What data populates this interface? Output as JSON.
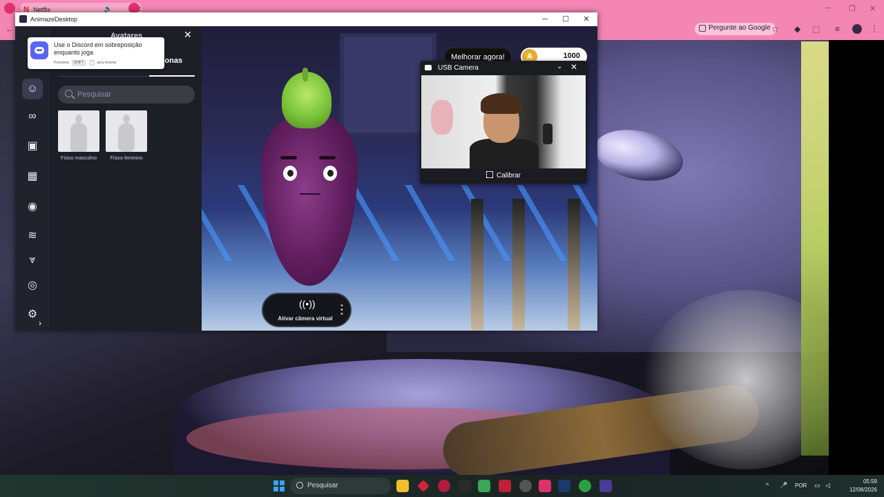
{
  "browser": {
    "tab_title": "Netflix",
    "google_button": "Pergunte ao Google"
  },
  "window": {
    "title": "AnimazeDesktop",
    "controls": {
      "minimize": "─",
      "maximize": "☐",
      "close": "✕"
    }
  },
  "discord_toast": {
    "message": "Use o Discord em sobreposição enquanto joga",
    "hint_prefix": "Pressione",
    "hint_key1": "SHIFT",
    "hint_key2": "`",
    "hint_suffix": "para mostrar"
  },
  "panel": {
    "title": "Avatares",
    "tab_active": "rsonas",
    "close": "✕",
    "search_placeholder": "Pesquisar",
    "avatars": [
      {
        "label": "Físico masculino"
      },
      {
        "label": "Físico feminino"
      }
    ]
  },
  "stage": {
    "upgrade_label": "Melhorar agora!",
    "coins": "1000",
    "coin_symbol": "A",
    "virtual_camera_label": "Ativar câmera virtual"
  },
  "camera_panel": {
    "title": "USB Camera",
    "calibrate_label": "Calibrar"
  },
  "taskbar": {
    "search_label": "Pesquisar",
    "language": "POR",
    "time": "05:59",
    "date": "12/08/2026"
  },
  "colors": {
    "browser_chrome": "#f486b4",
    "discord_brand": "#5865f2",
    "coin_gold": "#d89a16",
    "windows_blue": "#3aa3ff"
  }
}
